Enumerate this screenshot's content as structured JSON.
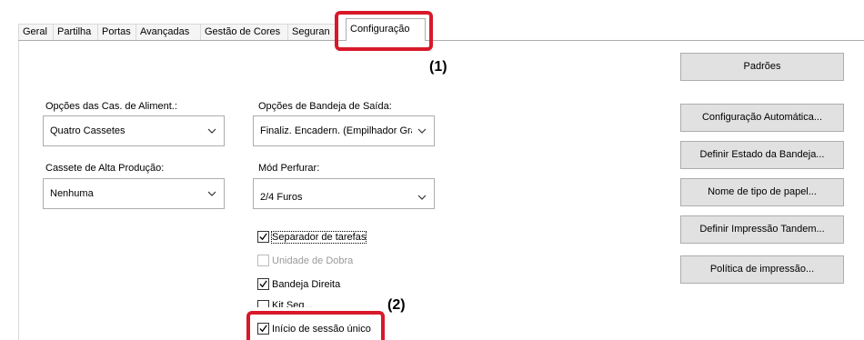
{
  "tabs": [
    {
      "label": "Geral"
    },
    {
      "label": "Partilha"
    },
    {
      "label": "Portas"
    },
    {
      "label": "Avançadas"
    },
    {
      "label": "Gestão de Cores"
    },
    {
      "label": "Seguran"
    },
    {
      "label": "Configuração"
    }
  ],
  "callouts": {
    "one": "(1)",
    "two": "(2)"
  },
  "paper_source": {
    "label": "Opções das Cas. de Aliment.:",
    "value": "Quatro Cassetes"
  },
  "high_capacity": {
    "label": "Cassete de Alta Produção:",
    "value": "Nenhuma"
  },
  "output_tray": {
    "label": "Opções de Bandeja de Saída:",
    "value": "Finaliz. Encadern. (Empilhador Gra"
  },
  "punch": {
    "label": "Mód Perfurar:",
    "value": "2/4 Furos"
  },
  "checkboxes": {
    "job_separator": {
      "label": "Separador de tarefas",
      "checked": true
    },
    "fold_unit": {
      "label": "Unidade de Dobra",
      "checked": false
    },
    "right_tray": {
      "label": "Bandeja Direita",
      "checked": true
    },
    "partial": {
      "label": "Kit Seg..."
    },
    "single_signon": {
      "label": "Início de sessão único",
      "checked": true
    }
  },
  "buttons": {
    "defaults": "Padrões",
    "auto_config": "Configuração Automática...",
    "tray_status": "Definir Estado da Bandeja...",
    "paper_type_name": "Nome de tipo de papel...",
    "tandem_print": "Definir Impressão Tandem...",
    "print_policy": "Política de impressão..."
  },
  "colors": {
    "highlight": "#d7192a"
  }
}
